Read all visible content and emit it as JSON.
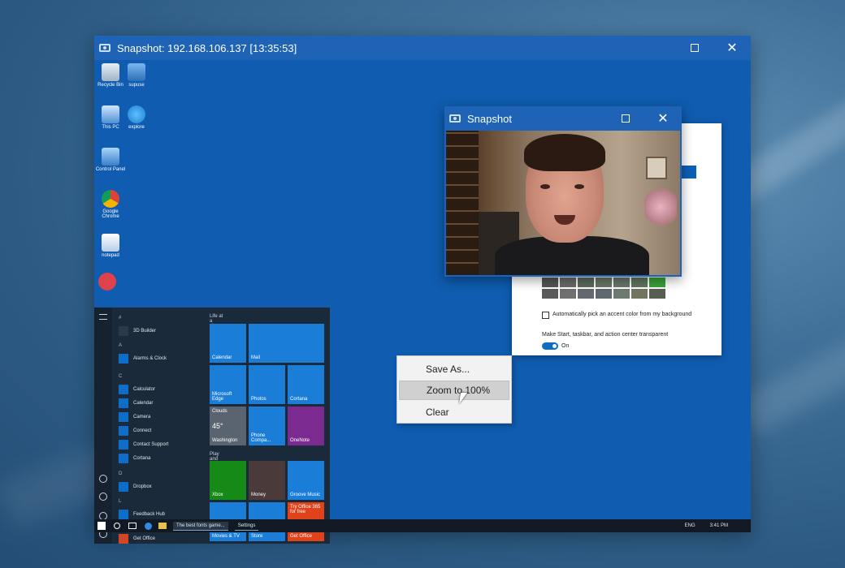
{
  "main_window": {
    "title": "Snapshot: 192.168.106.137 [13:35:53]",
    "maximize_icon": "maximize-icon",
    "close_icon": "close-icon",
    "close_glyph": "✕"
  },
  "desktop_icons": [
    {
      "label": "Recycle Bin",
      "icon": "recycle-bin-icon"
    },
    {
      "label": "supuse",
      "icon": "network-icon"
    },
    {
      "label": "This PC",
      "icon": "computer-icon"
    },
    {
      "label": "explore",
      "icon": "internet-explorer-icon"
    },
    {
      "label": "Control Panel",
      "icon": "control-panel-icon"
    },
    {
      "label": "Google Chrome",
      "icon": "chrome-icon"
    },
    {
      "label": "notepad",
      "icon": "notepad-icon"
    }
  ],
  "start_menu": {
    "letters": [
      "#",
      "A",
      "C",
      "D",
      "L"
    ],
    "apps": [
      "3D Builder",
      "Alarms & Clock",
      "Calculator",
      "Calendar",
      "Camera",
      "Connect",
      "Contact Support",
      "Cortana",
      "Dropbox",
      "Feedback Hub",
      "Get Office"
    ],
    "group1": "Life at a glance",
    "group2": "Play and explore",
    "tiles": [
      {
        "label": "Calendar"
      },
      {
        "label": "Mail"
      },
      {
        "label": "Microsoft Edge"
      },
      {
        "label": "Photos"
      },
      {
        "label": "Cortana"
      },
      {
        "label": "Washington"
      },
      {
        "label": "Phone Compa..."
      },
      {
        "label": "OneNote"
      },
      {
        "label": "Xbox"
      },
      {
        "label": "Money"
      },
      {
        "label": "Groove Music"
      },
      {
        "label": "Movies & TV"
      },
      {
        "label": "Store"
      },
      {
        "label": "Get Office"
      }
    ],
    "weather": {
      "condition": "Clouds",
      "temp": "45°",
      "hi": "47°",
      "lo": "42°"
    },
    "office_tile_text": "Try Office 365 for free"
  },
  "taskbar": {
    "items": [
      "The best fonts game...",
      "Settings"
    ],
    "lang": "ENG",
    "time": "3:41 PM"
  },
  "settings_window": {
    "checkbox_label": "Automatically pick an accent color from my background",
    "transparency_label": "Make Start, taskbar, and action center transparent",
    "toggle_state": "On",
    "swatch_colors": [
      "#555555",
      "#6b6b6b",
      "#5c6b5e",
      "#6a7666",
      "#69766d",
      "#607660",
      "#3aa33a",
      "#5a5a5a",
      "#707070",
      "#666a70",
      "#5f6870",
      "#6d7a72",
      "#727660",
      "#595e52"
    ]
  },
  "snapshot_window": {
    "title": "Snapshot",
    "close_glyph": "✕"
  },
  "context_menu": {
    "items": [
      "Save As...",
      "Zoom to 100%",
      "Clear"
    ],
    "highlighted_index": 1
  }
}
